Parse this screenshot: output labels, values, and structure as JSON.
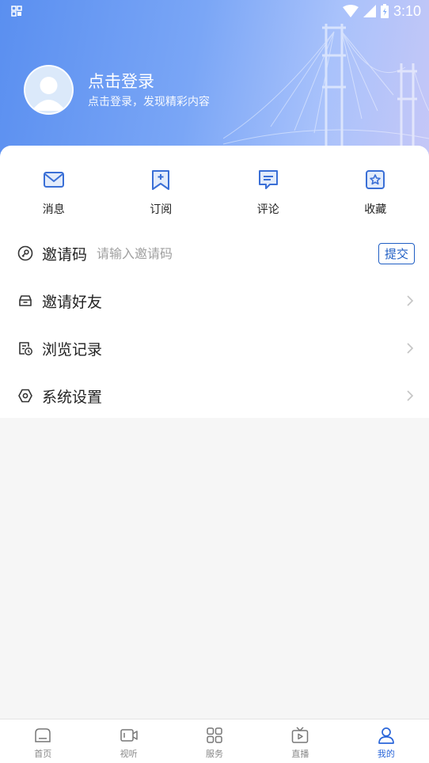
{
  "status_bar": {
    "time": "3:10"
  },
  "profile": {
    "login_title": "点击登录",
    "login_subtitle": "点击登录，发现精彩内容"
  },
  "quick_actions": [
    {
      "label": "消息",
      "icon": "mail-icon"
    },
    {
      "label": "订阅",
      "icon": "subscribe-bookmark-icon"
    },
    {
      "label": "评论",
      "icon": "comment-icon"
    },
    {
      "label": "收藏",
      "icon": "star-icon"
    }
  ],
  "invite": {
    "label": "邀请码",
    "placeholder": "请输入邀请码",
    "submit_label": "提交"
  },
  "menu": [
    {
      "label": "邀请好友",
      "icon": "envelope-icon"
    },
    {
      "label": "浏览记录",
      "icon": "history-icon"
    },
    {
      "label": "系统设置",
      "icon": "settings-icon"
    }
  ],
  "tabbar": [
    {
      "label": "首页",
      "icon": "home-icon",
      "active": false
    },
    {
      "label": "视听",
      "icon": "video-icon",
      "active": false
    },
    {
      "label": "服务",
      "icon": "grid-icon",
      "active": false
    },
    {
      "label": "直播",
      "icon": "tv-icon",
      "active": false
    },
    {
      "label": "我的",
      "icon": "user-icon",
      "active": true
    }
  ],
  "colors": {
    "accent": "#2a66d9",
    "icon_blue": "#3a6fd6",
    "header_start": "#5a8ff0"
  }
}
